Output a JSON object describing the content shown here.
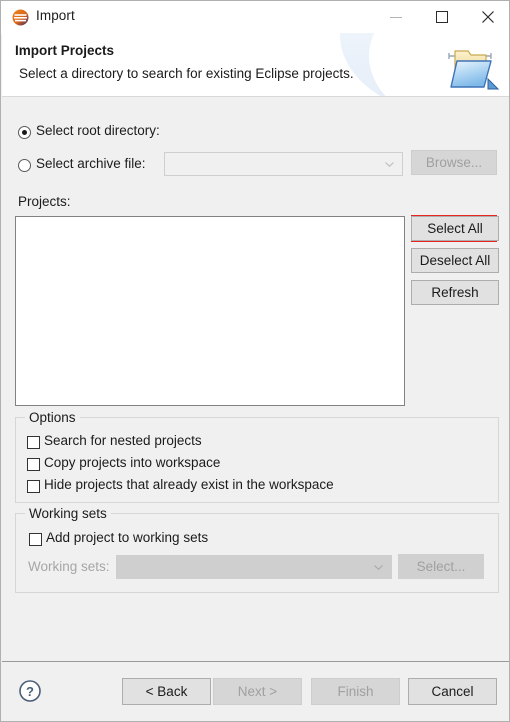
{
  "window": {
    "title": "Import",
    "app_icon": "eclipse-icon",
    "controls": {
      "minimize": "minimize-icon",
      "maximize": "maximize-icon",
      "close": "close-icon"
    }
  },
  "header": {
    "title": "Import Projects",
    "subtitle": "Select a directory to search for existing Eclipse projects.",
    "icon": "import-folder-icon"
  },
  "source": {
    "root_directory": {
      "label": "Select root directory:",
      "selected": true,
      "value": "",
      "placeholder": "",
      "browse_label": "Browse...",
      "browse_focused": true
    },
    "archive_file": {
      "label": "Select archive file:",
      "selected": false,
      "value": "",
      "placeholder": "",
      "browse_label": "Browse...",
      "disabled": true
    }
  },
  "projects": {
    "label": "Projects:",
    "items": [],
    "buttons": {
      "select_all": "Select All",
      "deselect_all": "Deselect All",
      "refresh": "Refresh"
    }
  },
  "options": {
    "title": "Options",
    "items": [
      {
        "label": "Search for nested projects",
        "checked": false
      },
      {
        "label": "Copy projects into workspace",
        "checked": false
      },
      {
        "label": "Hide projects that already exist in the workspace",
        "checked": false
      }
    ]
  },
  "working_sets": {
    "title": "Working sets",
    "add_checkbox": {
      "label": "Add project to working sets",
      "checked": false
    },
    "combo_label": "Working sets:",
    "combo_value": "",
    "select_label": "Select..."
  },
  "footer": {
    "help_icon": "help-icon",
    "back_label": "< Back",
    "next_label": "Next >",
    "finish_label": "Finish",
    "cancel_label": "Cancel",
    "back_enabled": true,
    "next_enabled": false,
    "finish_enabled": false,
    "cancel_enabled": true
  },
  "colors": {
    "focus_red": "#e8251f",
    "focus_blue": "#2e7fd0",
    "dialog_bg": "#f0f0f0",
    "field_bg": "#ffffff"
  }
}
